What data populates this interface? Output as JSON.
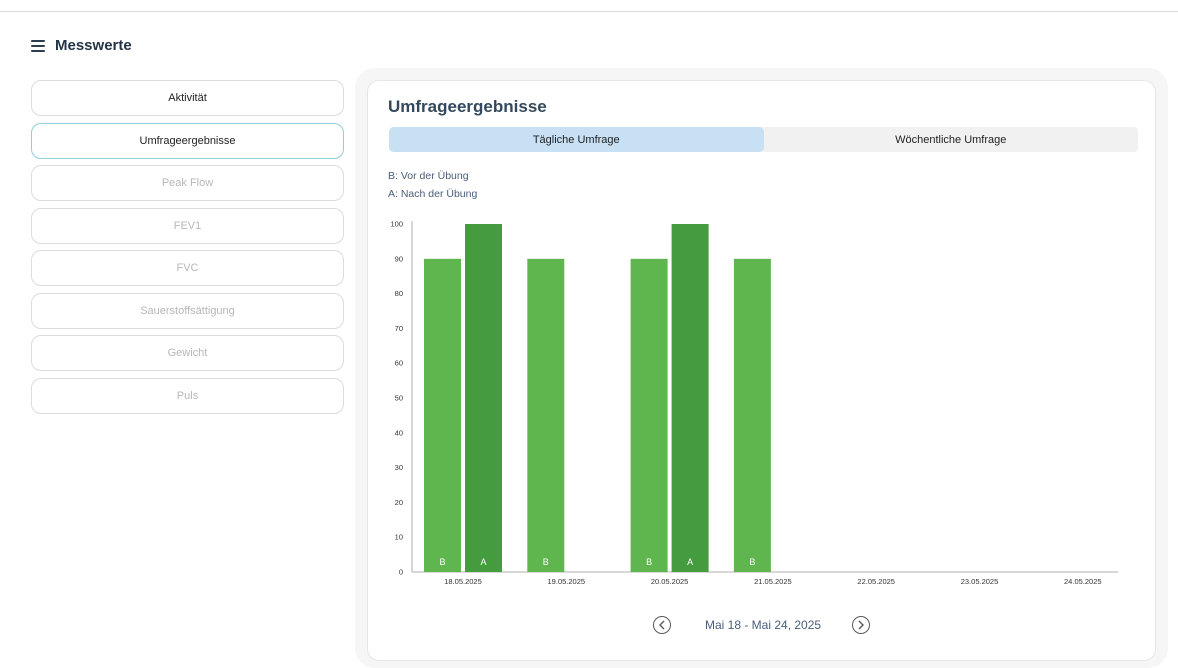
{
  "header": {
    "title": "Messwerte",
    "menu_icon": "hamburger-menu-icon"
  },
  "sidebar": {
    "items": [
      {
        "label": "Aktivität",
        "state": "enabled"
      },
      {
        "label": "Umfrageergebnisse",
        "state": "active"
      },
      {
        "label": "Peak Flow",
        "state": "disabled"
      },
      {
        "label": "FEV1",
        "state": "disabled"
      },
      {
        "label": "FVC",
        "state": "disabled"
      },
      {
        "label": "Sauerstoffsättigung",
        "state": "disabled"
      },
      {
        "label": "Gewicht",
        "state": "disabled"
      },
      {
        "label": "Puls",
        "state": "disabled"
      }
    ]
  },
  "panel": {
    "title": "Umfrageergebnisse",
    "tabs": [
      {
        "label": "Tägliche Umfrage",
        "active": true
      },
      {
        "label": "Wöchentliche Umfrage",
        "active": false
      }
    ],
    "legend": {
      "before": "B: Vor der Übung",
      "after": "A: Nach der Übung"
    }
  },
  "colors": {
    "before_bar": "#5fb54e",
    "after_bar": "#449c3f",
    "active_tab": "#c7e0f4",
    "active_border": "#8fcfd6"
  },
  "chart_data": {
    "type": "bar",
    "categories": [
      "18.05.2025",
      "19.05.2025",
      "20.05.2025",
      "21.05.2025",
      "22.05.2025",
      "23.05.2025",
      "24.05.2025"
    ],
    "series": [
      {
        "name": "B",
        "values": [
          90,
          90,
          90,
          90,
          null,
          null,
          null
        ]
      },
      {
        "name": "A",
        "values": [
          100,
          null,
          100,
          null,
          null,
          null,
          null
        ]
      }
    ],
    "ylim": [
      0,
      100
    ],
    "yticks": [
      0,
      10,
      20,
      30,
      40,
      50,
      60,
      70,
      80,
      90,
      100
    ],
    "grid": false
  },
  "pager": {
    "range_text": "Mai 18 - Mai 24, 2025",
    "prev_icon": "chevron-left-icon",
    "next_icon": "chevron-right-icon"
  }
}
